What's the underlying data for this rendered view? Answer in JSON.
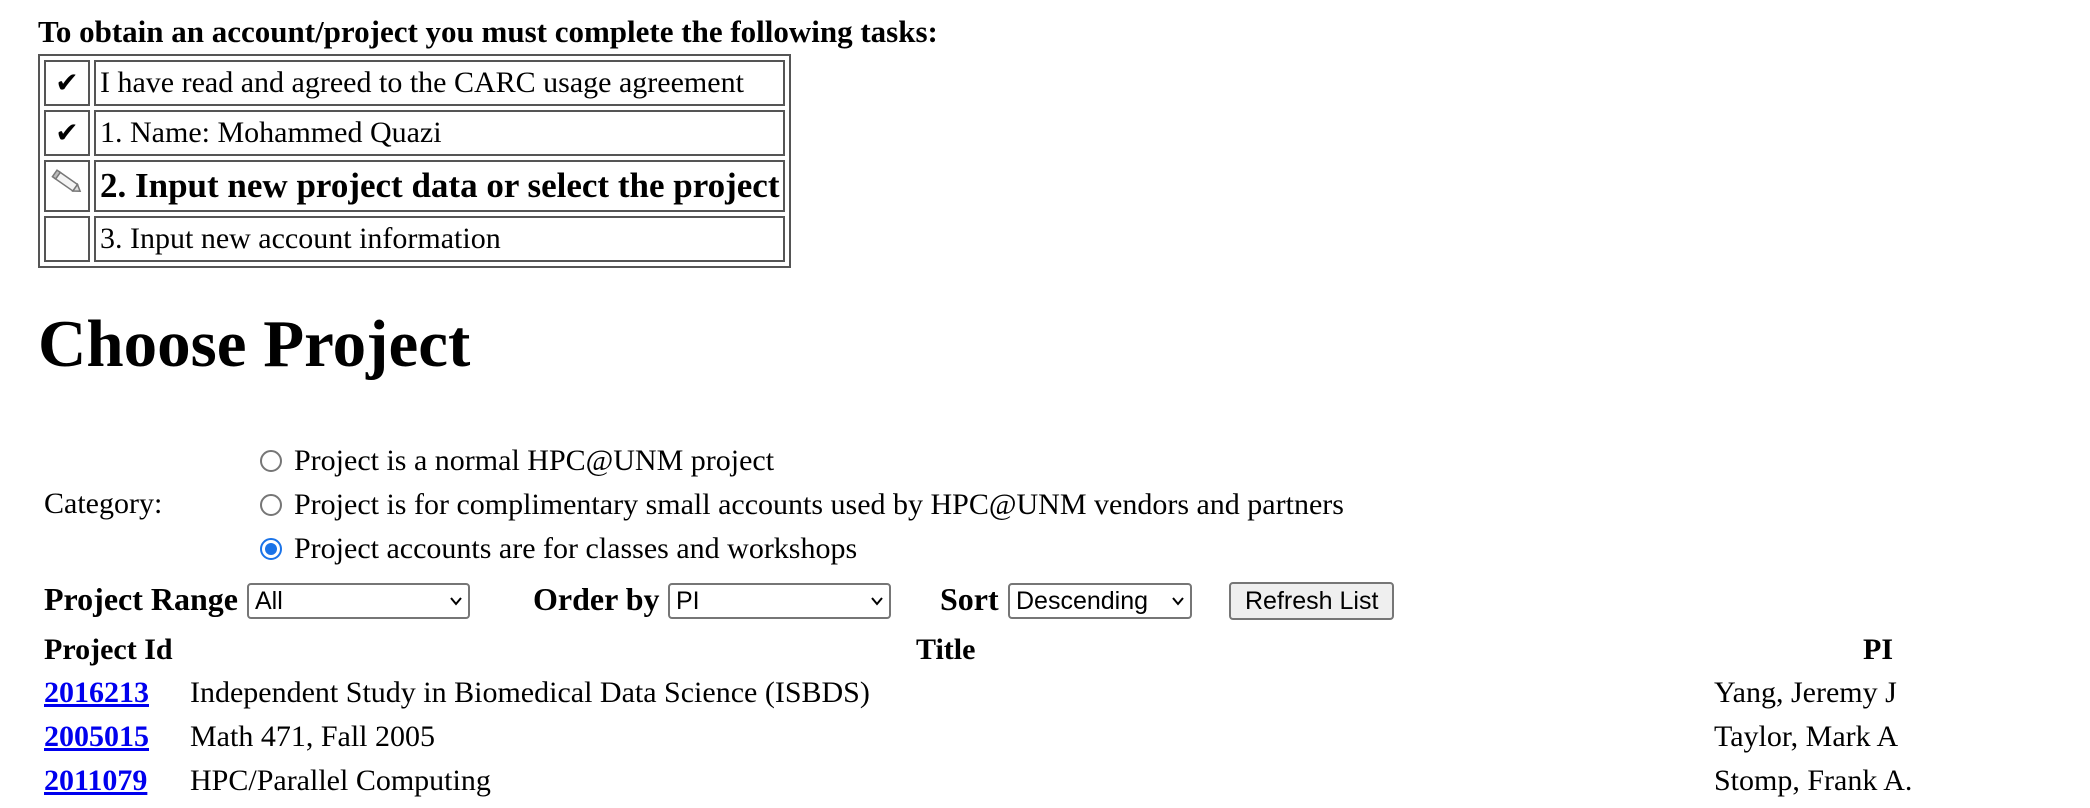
{
  "intro": "To obtain an account/project you must complete the following tasks:",
  "tasks": [
    {
      "status": "done",
      "icon": "checkmark-icon",
      "label": "I have read and agreed to the CARC usage agreement"
    },
    {
      "status": "done",
      "icon": "checkmark-icon",
      "label": "1. Name: Mohammed Quazi"
    },
    {
      "status": "current",
      "icon": "pencil-icon",
      "label": "2. Input new project data or select the project"
    },
    {
      "status": "pending",
      "icon": "",
      "label": "3. Input new account information"
    }
  ],
  "heading": "Choose Project",
  "category": {
    "label": "Category:",
    "options": [
      {
        "label": "Project is a normal HPC@UNM project",
        "checked": false
      },
      {
        "label": "Project is for complimentary small accounts used by HPC@UNM vendors and partners",
        "checked": false
      },
      {
        "label": "Project accounts are for classes and workshops",
        "checked": true
      }
    ]
  },
  "controls": {
    "range_label": "Project Range",
    "range_value": "All",
    "order_label": "Order by",
    "order_value": "PI",
    "sort_label": "Sort",
    "sort_value": "Descending",
    "refresh_label": "Refresh List"
  },
  "table": {
    "headers": {
      "id": "Project Id",
      "title": "Title",
      "pi": "PI"
    },
    "rows": [
      {
        "id": "2016213",
        "title": "Independent Study in Biomedical Data Science (ISBDS)",
        "pi": "Yang, Jeremy J"
      },
      {
        "id": "2005015",
        "title": "Math 471, Fall 2005",
        "pi": "Taylor, Mark A"
      },
      {
        "id": "2011079",
        "title": "HPC/Parallel Computing",
        "pi": "Stomp, Frank A."
      }
    ]
  },
  "colors": {
    "link": "#0000ee",
    "radio_checked": "#1a73e8"
  }
}
